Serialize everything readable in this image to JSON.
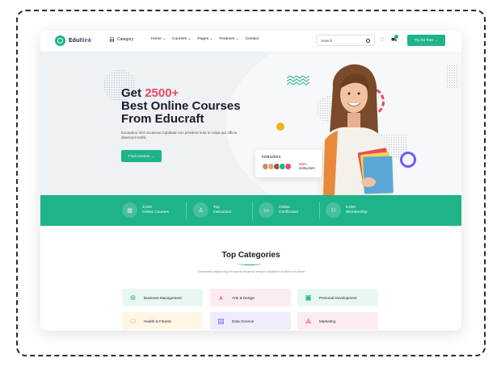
{
  "brand": {
    "name_bold": "Edu",
    "name_rest": "Blink"
  },
  "nav": {
    "category_label": "Category",
    "menu": [
      "Home ⌄",
      "Courses ⌄",
      "Pages ⌄",
      "Features ⌄",
      "Contact"
    ],
    "search_placeholder": "Search",
    "cta_label": "Try for free →"
  },
  "hero": {
    "title_get": "Get",
    "title_number": "2500+",
    "title_line2": "Best Online Courses",
    "title_line3": "From Educraft",
    "description": "Excepteur sint occaecat cupidatat non proident sunt in culpa qui officia deserunt mollit.",
    "button_label": "Find courses →",
    "instructors_title": "Instructors",
    "instructors_count": "200+",
    "instructors_count_label": "Instructors"
  },
  "stats": [
    {
      "value": "3,020",
      "label": "Online Courses",
      "icon": "books-icon"
    },
    {
      "value": "Top",
      "label": "Instructors",
      "icon": "teacher-icon"
    },
    {
      "value": "Online",
      "label": "Certificates",
      "icon": "certificate-icon"
    },
    {
      "value": "6,000",
      "label": "Membership",
      "icon": "members-icon"
    }
  ],
  "categories": {
    "title": "Top Categories",
    "subtitle": "Consectetur adipiscing elit sed do eiusmod tempor incididunt ut labore et dolore",
    "items": [
      {
        "label": "Business Management",
        "icon": "briefcase-icon",
        "bg": "#e8f7f2",
        "color": "#1fb389"
      },
      {
        "label": "Arts & Design",
        "icon": "easel-icon",
        "bg": "#fdecef",
        "color": "#ef4565"
      },
      {
        "label": "Personal Development",
        "icon": "person-board-icon",
        "bg": "#e8f7f2",
        "color": "#1fb389"
      },
      {
        "label": "Health & Fitness",
        "icon": "pills-icon",
        "bg": "#fff6e6",
        "color": "#f7b21b"
      },
      {
        "label": "Data Science",
        "icon": "data-icon",
        "bg": "#efedfd",
        "color": "#6f5cf6"
      },
      {
        "label": "Marketing",
        "icon": "megaphone-icon",
        "bg": "#fdecf3",
        "color": "#ef4565"
      }
    ]
  },
  "colors": {
    "accent": "#1fb389",
    "highlight": "#ef4565",
    "yellow": "#f7b21b",
    "purple": "#6f5cf6"
  }
}
